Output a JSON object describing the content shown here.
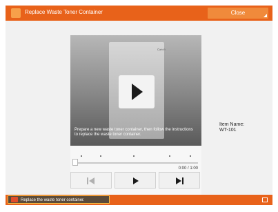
{
  "titlebar": {
    "title": "Replace Waste Toner Container",
    "close_label": "Close",
    "icon": "info-icon"
  },
  "video": {
    "caption": "Prepare a new waste toner container, then follow the instructions to replace the waste toner container.",
    "play_icon": "play-icon",
    "brand_text": "Canon"
  },
  "timeline": {
    "time": "0:00 / 1:00"
  },
  "controls": {
    "skip_back_icon": "skip-back-icon",
    "play_icon": "play-icon",
    "skip_forward_icon": "skip-forward-icon"
  },
  "item": {
    "label": "Item Name:",
    "value": "WT-101"
  },
  "status": {
    "text": "Replace the waste toner container.",
    "icon": "warning-icon"
  },
  "colors": {
    "accent_orange": "#e8621a",
    "status_border": "#f0c04a"
  }
}
